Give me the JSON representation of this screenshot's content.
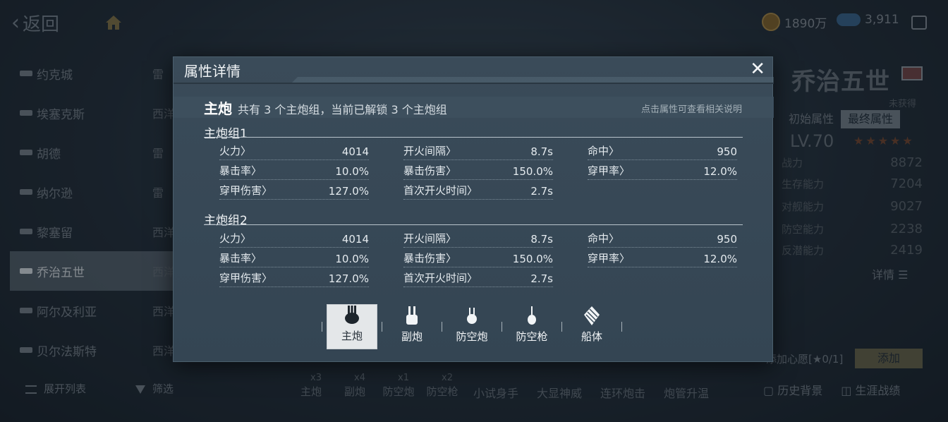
{
  "topbar": {
    "back_label": "返回",
    "coins": "1890万",
    "gems": "3,911"
  },
  "shiplist": {
    "items": [
      {
        "name": "约克城",
        "type": "雷",
        "active": false
      },
      {
        "name": "埃塞克斯",
        "type": "西洋",
        "active": false
      },
      {
        "name": "胡德",
        "type": "雷",
        "active": false
      },
      {
        "name": "纳尔逊",
        "type": "雷",
        "active": false
      },
      {
        "name": "黎塞留",
        "type": "西洋",
        "active": false
      },
      {
        "name": "乔治五世",
        "type": "西洋",
        "active": true
      },
      {
        "name": "阿尔及利亚",
        "type": "西洋",
        "active": false
      },
      {
        "name": "贝尔法斯特",
        "type": "西洋",
        "active": false
      }
    ],
    "expand_label": "展开列表",
    "filter_label": "筛选"
  },
  "rightpanel": {
    "ship_name": "乔治五世",
    "status": "未获得",
    "tab_initial": "初始属性",
    "tab_final": "最终属性",
    "level": "LV.70",
    "stars": "★★★★★",
    "stats": [
      {
        "label": "战力",
        "value": "8872"
      },
      {
        "label": "生存能力",
        "value": "7204"
      },
      {
        "label": "对舰能力",
        "value": "9027"
      },
      {
        "label": "防空能力",
        "value": "2238"
      },
      {
        "label": "反潜能力",
        "value": "2419"
      }
    ],
    "detail_label": "详情",
    "wish_label": "添加心愿[",
    "wish_count": "0/1]",
    "add_label": "添加",
    "bottom_links": [
      "历史背景",
      "生涯战绩"
    ]
  },
  "skillbar": {
    "weapons": [
      {
        "label": "主炮",
        "count": "x3"
      },
      {
        "label": "副炮",
        "count": "x4"
      },
      {
        "label": "防空炮",
        "count": "x1"
      },
      {
        "label": "防空枪",
        "count": "x2"
      }
    ],
    "skills": [
      "小试身手",
      "大显神威",
      "连环炮击",
      "炮管升温"
    ]
  },
  "modal": {
    "title": "属性详情",
    "section_title": "主炮",
    "section_desc": "共有 3 个主炮组，当前已解锁 3 个主炮组",
    "hint": "点击属性可查看相关说明",
    "groups": [
      {
        "title": "主炮组1",
        "attrs": [
          {
            "label": "火力〉",
            "value": "4014"
          },
          {
            "label": "开火间隔〉",
            "value": "8.7s"
          },
          {
            "label": "命中〉",
            "value": "950"
          },
          {
            "label": "暴击率〉",
            "value": "10.0%"
          },
          {
            "label": "暴击伤害〉",
            "value": "150.0%"
          },
          {
            "label": "穿甲率〉",
            "value": "12.0%"
          },
          {
            "label": "穿甲伤害〉",
            "value": "127.0%"
          },
          {
            "label": "首次开火时间〉",
            "value": "2.7s"
          }
        ]
      },
      {
        "title": "主炮组2",
        "attrs": [
          {
            "label": "火力〉",
            "value": "4014"
          },
          {
            "label": "开火间隔〉",
            "value": "8.7s"
          },
          {
            "label": "命中〉",
            "value": "950"
          },
          {
            "label": "暴击率〉",
            "value": "10.0%"
          },
          {
            "label": "暴击伤害〉",
            "value": "150.0%"
          },
          {
            "label": "穿甲率〉",
            "value": "12.0%"
          },
          {
            "label": "穿甲伤害〉",
            "value": "127.0%"
          },
          {
            "label": "首次开火时间〉",
            "value": "2.7s"
          }
        ]
      }
    ],
    "tabs": [
      {
        "label": "主炮",
        "icon": "main-gun-icon",
        "active": true
      },
      {
        "label": "副炮",
        "icon": "secondary-gun-icon",
        "active": false
      },
      {
        "label": "防空炮",
        "icon": "aa-gun-icon",
        "active": false
      },
      {
        "label": "防空枪",
        "icon": "aa-mg-icon",
        "active": false
      },
      {
        "label": "船体",
        "icon": "hull-icon",
        "active": false
      }
    ]
  }
}
